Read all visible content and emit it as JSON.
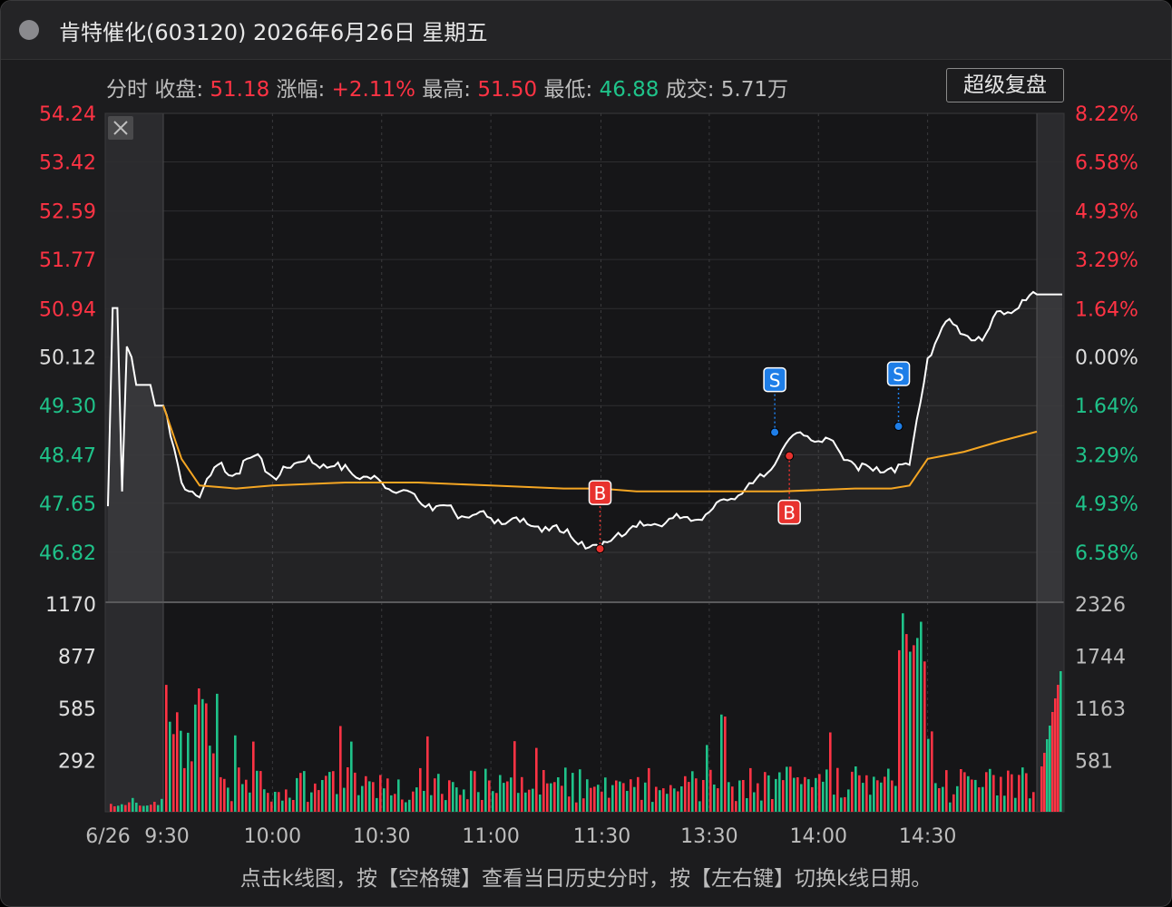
{
  "window": {
    "title": "肯特催化(603120) 2026年6月26日 星期五"
  },
  "info_bar": {
    "mode_label": "分时",
    "close_label": "收盘:",
    "close_value": "51.18",
    "change_label": "涨幅:",
    "change_value": "+2.11%",
    "high_label": "最高:",
    "high_value": "51.50",
    "low_label": "最低:",
    "low_value": "46.88",
    "volume_label": "成交:",
    "volume_value": "5.71万",
    "replay_button": "超级复盘"
  },
  "footer": {
    "hint": "点击k线图，按【空格键】查看当日历史分时，按【左右键】切换k线日期。"
  },
  "colors": {
    "up": "#ff3344",
    "down": "#1fc38a",
    "price_line": "#ffffff",
    "avg_line": "#f5a623",
    "buy_marker": "#e8322e",
    "sell_marker": "#1e7ee8"
  },
  "chart_data": [
    {
      "type": "line",
      "panel": "price",
      "y_tick_labels_left": [
        "54.24",
        "53.42",
        "52.59",
        "51.77",
        "50.94",
        "50.12",
        "49.30",
        "48.47",
        "47.65",
        "46.82"
      ],
      "y_tick_labels_right": [
        "8.22%",
        "6.58%",
        "4.93%",
        "3.29%",
        "1.64%",
        "0.00%",
        "1.64%",
        "3.29%",
        "4.93%",
        "6.58%"
      ],
      "ylim": [
        46.82,
        54.24
      ],
      "reference_price": 50.12,
      "x_tick_labels": [
        "6/26",
        "9:30",
        "10:00",
        "10:30",
        "11:00",
        "11:30",
        "13:30",
        "14:00",
        "14:30"
      ],
      "x_time_range": [
        "09:30",
        "15:00"
      ],
      "has_pre_market": true,
      "has_post_market": true,
      "pre_market": {
        "time": [
          "09:15",
          "09:16",
          "09:17",
          "09:18",
          "09:19",
          "09:20",
          "09:21",
          "09:22",
          "09:23",
          "09:24",
          "09:25"
        ],
        "price": [
          47.6,
          50.95,
          50.95,
          47.85,
          50.3,
          50.12,
          49.65,
          49.65,
          49.65,
          49.65,
          49.3
        ]
      },
      "series": [
        {
          "name": "价格",
          "x": [
            "09:30",
            "09:35",
            "09:40",
            "09:45",
            "09:50",
            "09:55",
            "10:00",
            "10:05",
            "10:10",
            "10:15",
            "10:20",
            "10:25",
            "10:30",
            "10:35",
            "10:40",
            "10:45",
            "10:50",
            "10:55",
            "11:00",
            "11:05",
            "11:10",
            "11:15",
            "11:20",
            "11:25",
            "11:30",
            "13:05",
            "13:10",
            "13:15",
            "13:20",
            "13:25",
            "13:30",
            "13:35",
            "13:40",
            "13:45",
            "13:50",
            "13:55",
            "14:00",
            "14:05",
            "14:10",
            "14:15",
            "14:20",
            "14:25",
            "14:30",
            "14:35",
            "14:40",
            "14:45",
            "14:50",
            "14:55",
            "15:00"
          ],
          "y": [
            49.3,
            48.0,
            47.75,
            48.3,
            48.15,
            48.45,
            48.1,
            48.25,
            48.45,
            48.25,
            48.3,
            48.1,
            48.0,
            47.85,
            47.7,
            47.6,
            47.5,
            47.45,
            47.4,
            47.35,
            47.3,
            47.25,
            47.15,
            47.0,
            46.88,
            47.15,
            47.25,
            47.3,
            47.4,
            47.35,
            47.5,
            47.7,
            47.9,
            48.1,
            48.55,
            48.85,
            48.7,
            48.6,
            48.3,
            48.2,
            48.25,
            48.3,
            50.1,
            50.72,
            50.5,
            50.4,
            50.9,
            50.95,
            51.18
          ]
        },
        {
          "name": "均价",
          "x": [
            "09:30",
            "09:35",
            "09:40",
            "09:50",
            "10:00",
            "10:20",
            "10:40",
            "11:00",
            "11:20",
            "11:30",
            "13:10",
            "13:30",
            "13:50",
            "14:10",
            "14:20",
            "14:25",
            "14:30",
            "14:40",
            "14:50",
            "15:00"
          ],
          "y": [
            49.3,
            48.4,
            47.95,
            47.9,
            47.95,
            48.0,
            48.0,
            47.95,
            47.9,
            47.9,
            47.85,
            47.85,
            47.85,
            47.9,
            47.9,
            47.95,
            48.4,
            48.52,
            48.7,
            48.86
          ]
        }
      ],
      "trade_markers": [
        {
          "label": "B",
          "side": "buy",
          "time": "11:30",
          "price": 46.88
        },
        {
          "label": "S",
          "side": "sell",
          "time": "13:48",
          "price": 48.85
        },
        {
          "label": "B",
          "side": "buy",
          "time": "13:52",
          "price": 48.45
        },
        {
          "label": "S",
          "side": "sell",
          "time": "14:22",
          "price": 48.95
        }
      ]
    },
    {
      "type": "bar",
      "panel": "volume",
      "y_tick_labels_left": [
        "1170",
        "877",
        "585",
        "292"
      ],
      "y_tick_labels_right": [
        "2326",
        "1744",
        "1163",
        "581"
      ],
      "ylim_left": [
        0,
        1170
      ],
      "ylim_right": [
        0,
        2326
      ]
    }
  ]
}
